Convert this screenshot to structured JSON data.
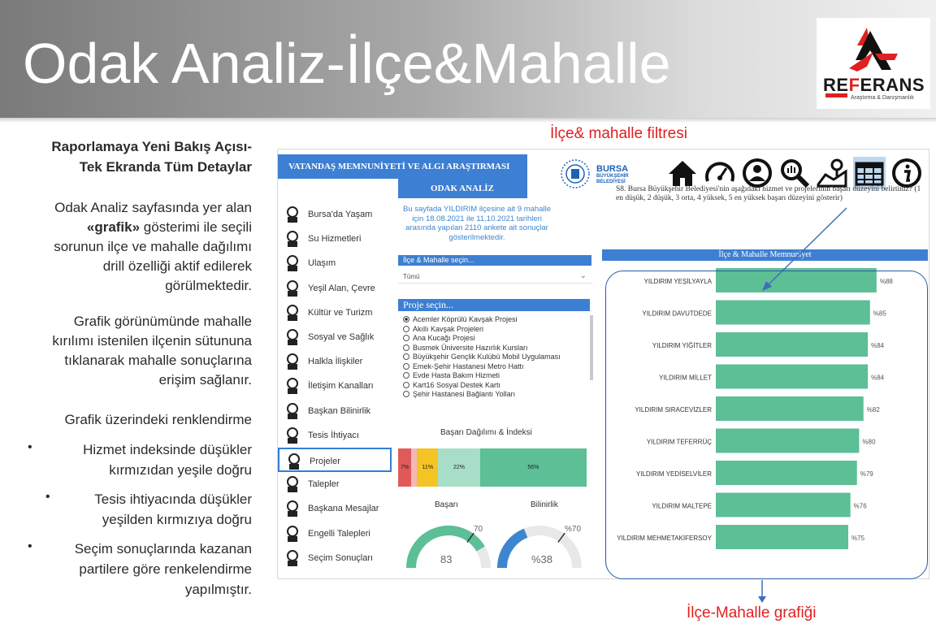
{
  "slide": {
    "title": "Odak Analiz-İlçe&Mahalle",
    "logo": {
      "word_pre": "RE",
      "word_mid": "F",
      "word_post": "ERANS",
      "sub": "Araştırma & Danışmanlık"
    }
  },
  "left_text": {
    "heading": [
      "Raporlamaya Yeni Bakış Açısı-",
      "Tek Ekranda Tüm Detaylar"
    ],
    "para1_pre": [
      "Odak Analiz sayfasında yer alan"
    ],
    "para1_bold": "«grafik»",
    "para1_after": " gösterimi ile seçili",
    "para1_rest": [
      "sorunun ilçe ve mahalle dağılımı",
      "drill özelliği aktif edilerek",
      "görülmektedir."
    ],
    "para2": [
      "Grafik görünümünde mahalle",
      "kırılımı istenilen ilçenin sütununa",
      "tıklanarak mahalle sonuçlarına",
      "erişim sağlanır."
    ],
    "para3": "Grafik üzerindeki renklendirme",
    "bullets": [
      [
        "Hizmet indeksinde düşükler",
        "kırmızıdan yeşile doğru"
      ],
      [
        "Tesis ihtiyacında düşükler",
        "yeşilden kırmızıya doğru"
      ],
      [
        "Seçim sonuçlarında kazanan",
        "partilere göre renkelendirme",
        "yapılmıştır."
      ]
    ]
  },
  "annotations": {
    "filter": "İlçe& mahalle filtresi",
    "chart": "İlçe-Mahalle grafiği"
  },
  "dashboard": {
    "title": "VATANDAŞ MEMNUNİYETİ VE ALGI ARAŞTIRMASI",
    "subtitle": "ODAK ANALİZ",
    "bursa": {
      "name": "BURSA",
      "sub1": "BÜYÜKŞEHİR",
      "sub2": "BELEDİYESİ"
    },
    "nav_icons": [
      "home-icon",
      "speedometer-icon",
      "user-target-icon",
      "magnifier-icon",
      "map-pin-icon",
      "table-icon",
      "info-icon"
    ],
    "question": "S8. Bursa Büyükşehir Belediyesi'nin aşağıdaki hizmet ve projelerinin başarı düzeyini belirtiniz? (1 en düşük, 2 düşük, 3 orta, 4 yüksek, 5 en yüksek başarı düzeyini gösterir)",
    "info": "Bu sayfada YILDIRIM ilçesine ait 9 mahalle için 18.08.2021 ile 11.10.2021 tarihleri arasında yapılan 2110 ankete ait sonuçlar gösterilmektedir.",
    "menu": [
      "Bursa'da Yaşam",
      "Su Hizmetleri",
      "Ulaşım",
      "Yeşil Alan, Çevre",
      "Kültür ve Turizm",
      "Sosyal ve Sağlık",
      "Halkla İlişkiler",
      "İletişim Kanalları",
      "Başkan Bilinirlik",
      "Tesis İhtiyacı",
      "Projeler",
      "Talepler",
      "Başkana Mesajlar",
      "Engelli Talepleri",
      "Seçim Sonuçları"
    ],
    "menu_selected": "Projeler",
    "filter_ilce": {
      "label": "İlçe & Mahalle seçin...",
      "value": "Tümü"
    },
    "filter_proje": {
      "label": "Proje seçin...",
      "items": [
        "Acemler Köprülü Kavşak Projesi",
        "Akıllı Kavşak Projeleri",
        "Ana Kucağı Projesi",
        "Busmek Üniversite Hazırlık Kursları",
        "Büyükşehir Gençlik Kulübü Mobil Uygulaması",
        "Emek-Şehir Hastanesi Metro Hattı",
        "Evde Hasta Bakım Hizmeti",
        "Kart16 Sosyal Destek Kartı",
        "Şehir Hastanesi Bağlantı Yolları"
      ],
      "selected": 0
    },
    "distribution": {
      "title": "Başarı Dağılımı & İndeksi",
      "segments": [
        {
          "label": "7%",
          "value": 7,
          "color": "#e05a5a"
        },
        {
          "label": "",
          "value": 3,
          "color": "#f2b8b8"
        },
        {
          "label": "11%",
          "value": 11,
          "color": "#f3c423"
        },
        {
          "label": "22%",
          "value": 22,
          "color": "#a8dec8"
        },
        {
          "label": "56%",
          "value": 56,
          "color": "#5cbf96"
        }
      ]
    },
    "gauges": [
      {
        "title": "Başarı",
        "value": 83,
        "target": 70,
        "value_label": "83",
        "target_label": "70",
        "max": 100,
        "color": "#5cbf96"
      },
      {
        "title": "Bilinirlik",
        "value": 38,
        "target": 70,
        "value_label": "%38",
        "target_label": "%70",
        "max": 100,
        "color": "#3d86cf"
      }
    ],
    "chart_title": "İlçe & Mahalle Memnuniyet"
  },
  "chart_data": {
    "type": "bar",
    "orientation": "horizontal",
    "title": "İlçe & Mahalle Memnuniyet",
    "categories": [
      "YILDIRIM YEŞİLYAYLA",
      "YILDIRIM DAVUTDEDE",
      "YILDIRIM YİĞİTLER",
      "YILDIRIM MİLLET",
      "YILDIRIM SIRACEVİZLER",
      "YILDIRIM TEFERRÜÇ",
      "YILDIRIM YEDİSELVİLER",
      "YILDIRIM MALTEPE",
      "YILDIRIM MEHMETAKİFERSOY"
    ],
    "values": [
      88,
      85,
      84,
      84,
      82,
      80,
      79,
      76,
      75
    ],
    "value_labels": [
      "%88",
      "%85",
      "%84",
      "%84",
      "%82",
      "%80",
      "%79",
      "%76",
      "%75"
    ],
    "xlim": [
      0,
      100
    ],
    "color": "#5cbf96"
  }
}
